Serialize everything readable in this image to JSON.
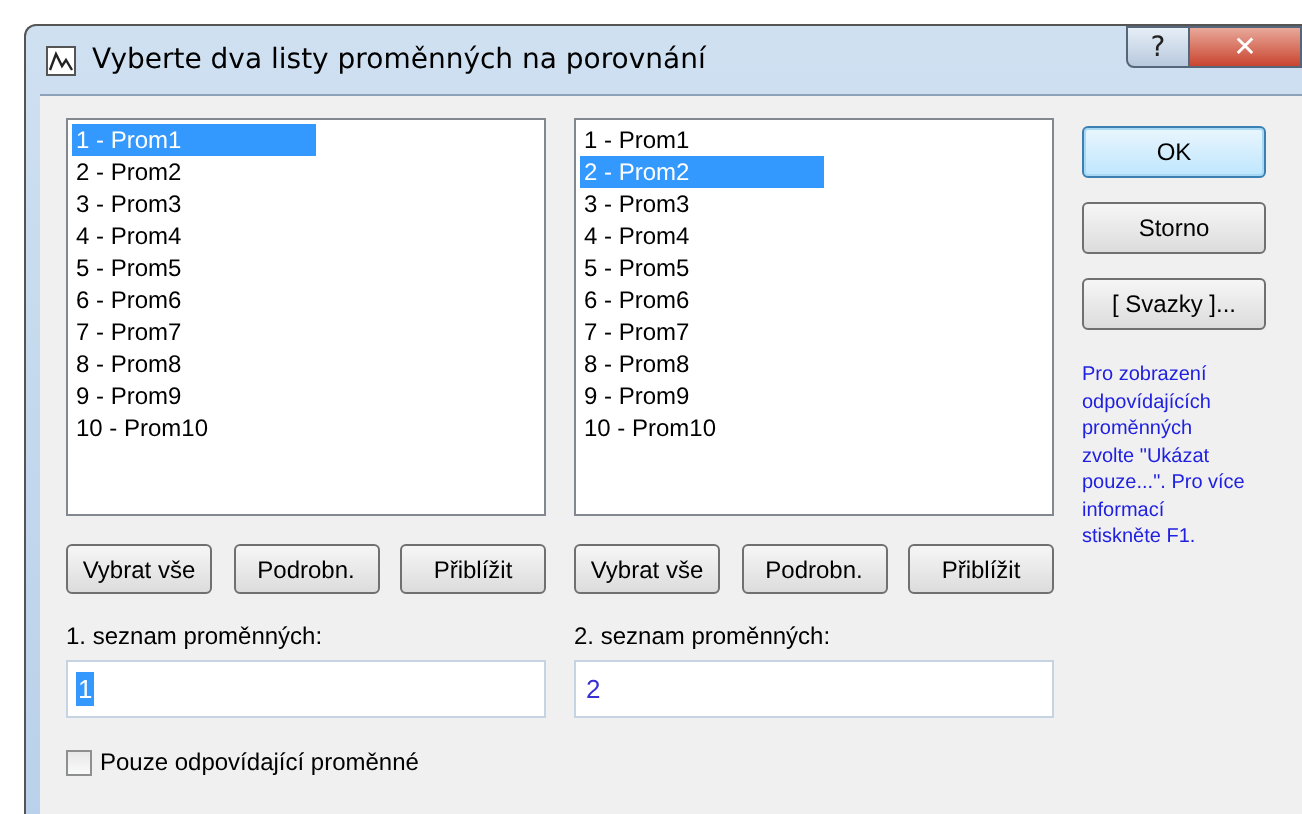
{
  "window": {
    "title": "Vyberte dva listy proměnných na porovnání",
    "help": "?",
    "close": "✕"
  },
  "lists": [
    {
      "items": [
        {
          "label": "1 - Prom1",
          "selected": true
        },
        {
          "label": "2 - Prom2",
          "selected": false
        },
        {
          "label": "3 - Prom3",
          "selected": false
        },
        {
          "label": "4 - Prom4",
          "selected": false
        },
        {
          "label": "5 - Prom5",
          "selected": false
        },
        {
          "label": "6 - Prom6",
          "selected": false
        },
        {
          "label": "7 - Prom7",
          "selected": false
        },
        {
          "label": "8 - Prom8",
          "selected": false
        },
        {
          "label": "9 - Prom9",
          "selected": false
        },
        {
          "label": "10 - Prom10",
          "selected": false
        }
      ],
      "buttons": [
        "Vybrat vše",
        "Podrobn.",
        "Přiblížit"
      ],
      "field": {
        "label": "1. seznam proměnných:",
        "value": "1",
        "text_selected": true
      }
    },
    {
      "items": [
        {
          "label": "1 - Prom1",
          "selected": false
        },
        {
          "label": "2 - Prom2",
          "selected": true
        },
        {
          "label": "3 - Prom3",
          "selected": false
        },
        {
          "label": "4 - Prom4",
          "selected": false
        },
        {
          "label": "5 - Prom5",
          "selected": false
        },
        {
          "label": "6 - Prom6",
          "selected": false
        },
        {
          "label": "7 - Prom7",
          "selected": false
        },
        {
          "label": "8 - Prom8",
          "selected": false
        },
        {
          "label": "9 - Prom9",
          "selected": false
        },
        {
          "label": "10 - Prom10",
          "selected": false
        }
      ],
      "buttons": [
        "Vybrat vše",
        "Podrobn.",
        "Přiblížit"
      ],
      "field": {
        "label": "2. seznam proměnných:",
        "value": "2",
        "text_selected": false
      }
    }
  ],
  "checkbox": {
    "label": "Pouze odpovídající proměnné",
    "checked": false
  },
  "side_buttons": [
    {
      "label": "OK",
      "default": true
    },
    {
      "label": "Storno",
      "default": false
    },
    {
      "label": "[ Svazky ]...",
      "default": false
    }
  ],
  "hint": "Pro zobrazení odpovídajících proměnných zvolte \"Ukázat pouze...\". Pro více informací stiskněte F1."
}
